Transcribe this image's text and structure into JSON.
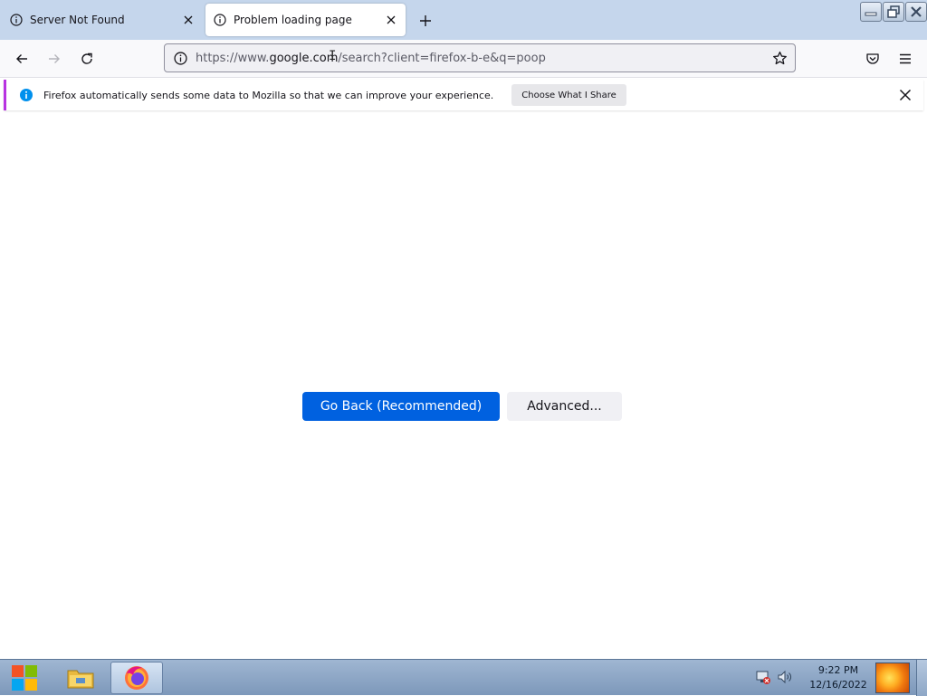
{
  "tabs": [
    {
      "title": "Server Not Found",
      "active": false
    },
    {
      "title": "Problem loading page",
      "active": true
    }
  ],
  "urlbar": {
    "prefix": "https://www.",
    "host": "google.com",
    "path": "/search?client=firefox-b-e&q=poop"
  },
  "notification": {
    "message": "Firefox automatically sends some data to Mozilla so that we can improve your experience.",
    "button_label": "Choose What I Share"
  },
  "error_page": {
    "go_back_label": "Go Back (Recommended)",
    "advanced_label": "Advanced..."
  },
  "taskbar": {
    "time": "9:22 PM",
    "date": "12/16/2022"
  },
  "colors": {
    "accent": "#0061e0",
    "tabstrip": "#c5d6ec",
    "notification_border": "#b833e1"
  },
  "icons": [
    "info-icon",
    "close-icon",
    "plus-icon",
    "back-icon",
    "forward-icon",
    "reload-icon",
    "star-icon",
    "pocket-icon",
    "menu-icon",
    "windows-start-icon",
    "file-explorer-icon",
    "firefox-icon",
    "network-icon",
    "volume-icon"
  ]
}
